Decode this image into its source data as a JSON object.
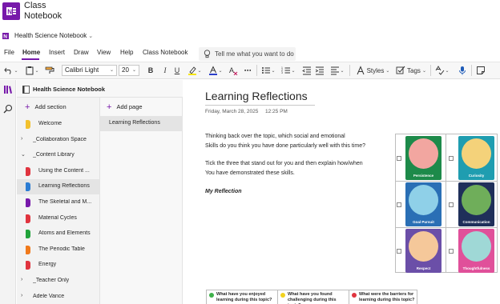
{
  "window": {
    "title_line1": "Class",
    "title_line2": "Notebook"
  },
  "notebook_bar": {
    "title": "Health Science Notebook"
  },
  "menu": {
    "items": [
      "File",
      "Home",
      "Insert",
      "Draw",
      "View",
      "Help",
      "Class Notebook"
    ],
    "active": "Home",
    "tell_me": "Tell me what you want to do"
  },
  "ribbon": {
    "font": "Calibri Light",
    "size": "20",
    "bold": "B",
    "italic": "I",
    "underline": "U",
    "styles_label": "Styles",
    "tags_label": "Tags",
    "accent_color": "#7719aa"
  },
  "pane": {
    "notebook_name": "Health Science Notebook",
    "add_section": "Add section",
    "add_page": "Add page",
    "sections": [
      {
        "label": "Welcome",
        "color": "#f2c12e",
        "type": "section"
      },
      {
        "label": "_Collaboration Space",
        "type": "group"
      },
      {
        "label": "_Content Library",
        "type": "group-open"
      },
      {
        "label": "Using the Content ...",
        "color": "#e0343f",
        "type": "section"
      },
      {
        "label": "Learning Reflections",
        "color": "#2b7cd3",
        "type": "section",
        "selected": true
      },
      {
        "label": "The Skeletal and M...",
        "color": "#7719aa",
        "type": "section"
      },
      {
        "label": "Material Cycles",
        "color": "#e0343f",
        "type": "section"
      },
      {
        "label": "Atoms and Elements",
        "color": "#22a33b",
        "type": "section"
      },
      {
        "label": "The Periodic Table",
        "color": "#f07a1c",
        "type": "section"
      },
      {
        "label": "Energy",
        "color": "#e0343f",
        "type": "section"
      },
      {
        "label": "_Teacher Only",
        "type": "group"
      },
      {
        "label": "Adele Vance",
        "type": "group"
      }
    ],
    "pages": [
      "Learning Reflections"
    ]
  },
  "page": {
    "title": "Learning Reflections",
    "date": "Friday, March 28, 2025",
    "time": "12:25 PM",
    "para1_line1": "Thinking back over the topic, which social and emotional",
    "para1_line2": "Skills do you think you have done particularly well with this time?",
    "para2_line1": "Tick the three that stand out for you and then explain how/when",
    "para2_line2": "You have demonstrated these skills.",
    "my_reflection": "My Reflection"
  },
  "skills": [
    {
      "caption": "Persistence",
      "bg": "#1d8a4a",
      "art": "#f2a6a0",
      "icon": "persistence-icon"
    },
    {
      "caption": "Curiosity",
      "bg": "#1f9db0",
      "art": "#f4d27a",
      "icon": "curiosity-icon"
    },
    {
      "caption": "Goal Pursuit",
      "bg": "#2a6fb5",
      "art": "#8fd0e8",
      "icon": "goal-pursuit-icon"
    },
    {
      "caption": "Communication",
      "bg": "#1f2f5a",
      "art": "#6fae5a",
      "icon": "communication-icon"
    },
    {
      "caption": "Respect",
      "bg": "#6b4fa8",
      "art": "#f5c89a",
      "icon": "respect-icon"
    },
    {
      "caption": "Thoughtfulness",
      "bg": "#e0509a",
      "art": "#9fd8d6",
      "icon": "thoughtfulness-icon"
    }
  ],
  "bottom_table": [
    {
      "text": "What have you enjoyed learning during this topic?",
      "dot": "#3fb04a"
    },
    {
      "text": "What have you found challenging during this topic?",
      "dot": "#f2d21e"
    },
    {
      "text": "What were the barriers for learning during this topic?",
      "dot": "#e0343f"
    }
  ]
}
